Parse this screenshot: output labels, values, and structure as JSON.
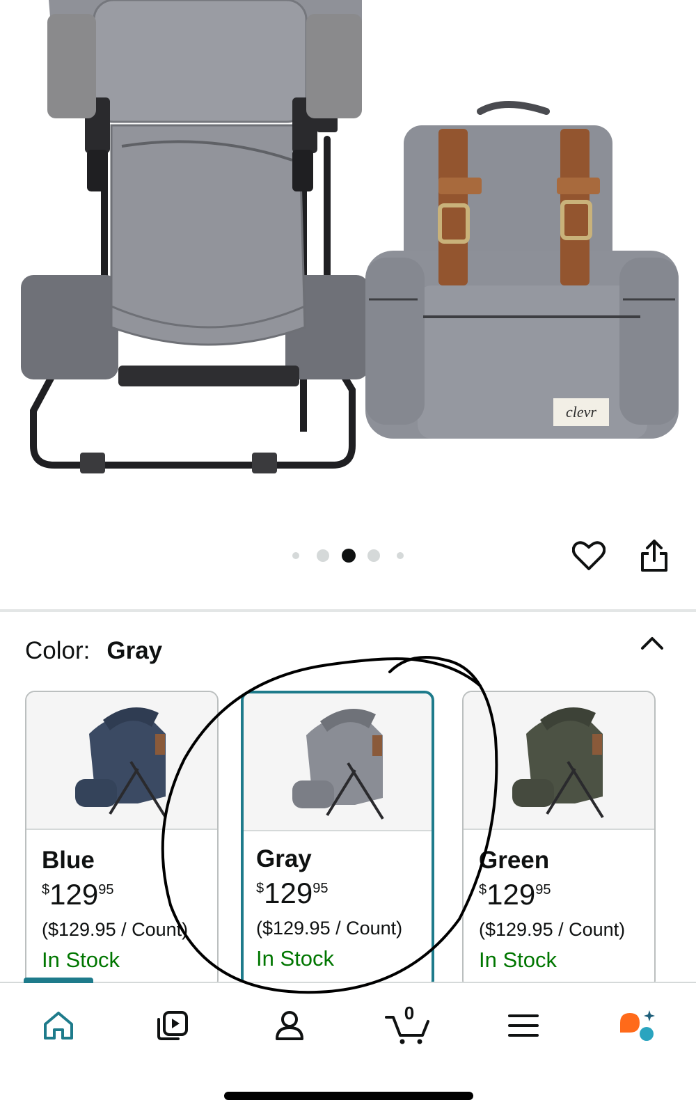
{
  "product_image": {
    "gallery_dots": 5,
    "active_dot_index": 2,
    "favorite_icon": "heart-icon",
    "share_icon": "share-icon"
  },
  "color_selector": {
    "label": "Color:",
    "selected": "Gray",
    "collapse_icon": "chevron-up-icon",
    "options": [
      {
        "name": "Blue",
        "price_symbol": "$",
        "price_whole": "129",
        "price_fraction": "95",
        "unit_price": "($129.95 / Count)",
        "availability": "In Stock",
        "swatch_color": "#3b4a63"
      },
      {
        "name": "Gray",
        "price_symbol": "$",
        "price_whole": "129",
        "price_fraction": "95",
        "unit_price": "($129.95 / Count)",
        "availability": "In Stock",
        "swatch_color": "#7d8089"
      },
      {
        "name": "Green",
        "price_symbol": "$",
        "price_whole": "129",
        "price_fraction": "95",
        "unit_price": "($129.95 / Count)",
        "availability": "In Stock",
        "swatch_color": "#4c5244"
      }
    ]
  },
  "bottom_nav": {
    "items": [
      "home-icon",
      "video-icon",
      "account-icon",
      "cart-icon",
      "menu-icon",
      "rufus-icon"
    ],
    "active_index": 0,
    "cart_count": "0"
  },
  "colors": {
    "accent": "#1e7b8b",
    "in_stock": "#007600",
    "rufus_orange": "#ff6a1a",
    "rufus_teal": "#2aa4bf"
  }
}
